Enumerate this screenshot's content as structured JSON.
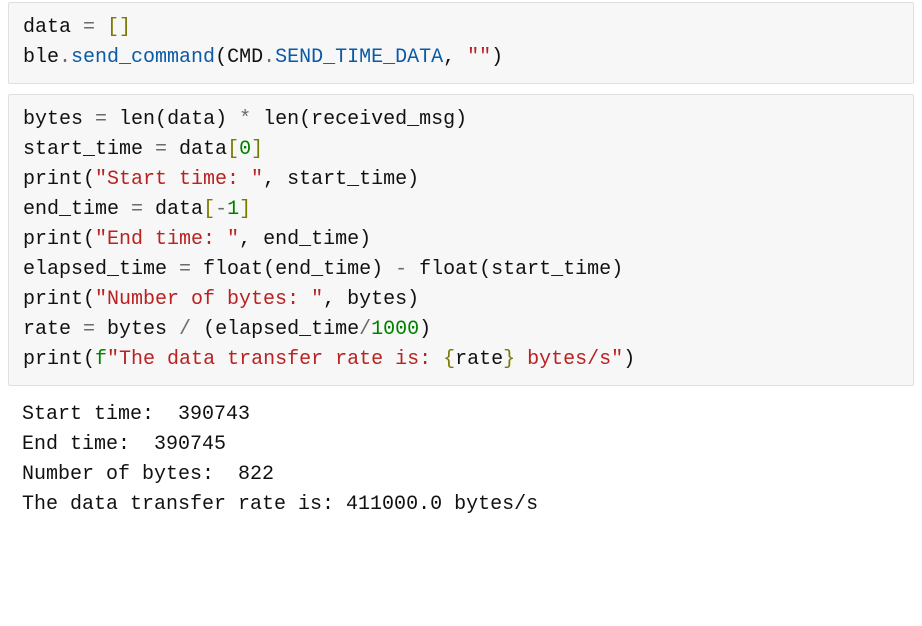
{
  "cells": {
    "code1": {
      "line1": {
        "t1": "data ",
        "t2": "= ",
        "t3": "[",
        "t4": "]"
      },
      "line2": {
        "t1": "ble",
        "t2": ".",
        "t3": "send_command",
        "t4": "(",
        "t5": "CMD",
        "t6": ".",
        "t7": "SEND_TIME_DATA",
        "t8": ", ",
        "t9": "\"\"",
        "t10": ")"
      }
    },
    "code2": {
      "line1": {
        "t1": "bytes ",
        "t2": "= ",
        "t3": "len",
        "t4": "(",
        "t5": "data",
        "t6": ") ",
        "t7": "* ",
        "t8": "len",
        "t9": "(",
        "t10": "received_msg",
        "t11": ")"
      },
      "line2": {
        "t1": "start_time ",
        "t2": "= ",
        "t3": "data",
        "t4": "[",
        "t5": "0",
        "t6": "]"
      },
      "line3": {
        "t1": "print",
        "t2": "(",
        "t3": "\"Start time: \"",
        "t4": ", ",
        "t5": "start_time",
        "t6": ")"
      },
      "line4": {
        "t1": "end_time ",
        "t2": "= ",
        "t3": "data",
        "t4": "[",
        "t5": "-",
        "t6": "1",
        "t7": "]"
      },
      "line5": {
        "t1": "print",
        "t2": "(",
        "t3": "\"End time: \"",
        "t4": ", ",
        "t5": "end_time",
        "t6": ")"
      },
      "line6": {
        "t1": "elapsed_time ",
        "t2": "= ",
        "t3": "float",
        "t4": "(",
        "t5": "end_time",
        "t6": ") ",
        "t7": "- ",
        "t8": "float",
        "t9": "(",
        "t10": "start_time",
        "t11": ")"
      },
      "line7": {
        "t1": "print",
        "t2": "(",
        "t3": "\"Number of bytes: \"",
        "t4": ", ",
        "t5": "bytes",
        "t6": ")"
      },
      "line8": {
        "t1": "rate ",
        "t2": "= ",
        "t3": "bytes ",
        "t4": "/ ",
        "t5": "(",
        "t6": "elapsed_time",
        "t7": "/",
        "t8": "1000",
        "t9": ")"
      },
      "line9": {
        "t1": "print",
        "t2": "(",
        "t3": "f",
        "t4": "\"The data transfer rate is: ",
        "t5": "{",
        "t6": "rate",
        "t7": "}",
        "t8": " bytes/s\"",
        "t9": ")"
      }
    },
    "output": {
      "line1": "Start time:  390743",
      "line2": "End time:  390745",
      "line3": "Number of bytes:  822",
      "line4": "The data transfer rate is: 411000.0 bytes/s"
    }
  }
}
